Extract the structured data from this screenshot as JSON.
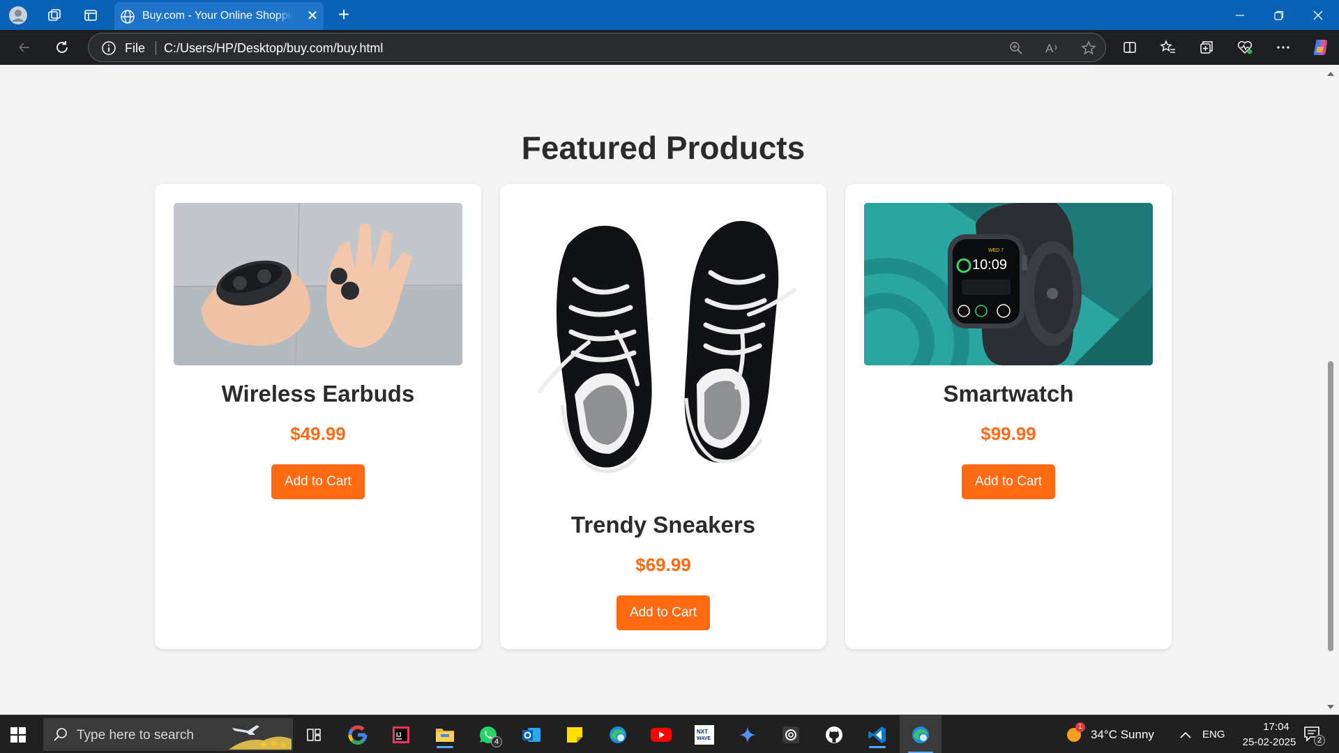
{
  "browser": {
    "tab_title": "Buy.com - Your Online Shopping Destination",
    "address_scheme": "File",
    "address_url": "C:/Users/HP/Desktop/buy.com/buy.html"
  },
  "page": {
    "heading": "Featured Products",
    "products": [
      {
        "name": "Wireless Earbuds",
        "price": "$49.99",
        "button": "Add to Cart",
        "image": "earbuds-photo"
      },
      {
        "name": "Trendy Sneakers",
        "price": "$69.99",
        "button": "Add to Cart",
        "image": "sneakers-photo"
      },
      {
        "name": "Smartwatch",
        "price": "$99.99",
        "button": "Add to Cart",
        "image": "smartwatch-photo"
      }
    ],
    "accent_color": "#ff6a13"
  },
  "taskbar": {
    "search_placeholder": "Type here to search",
    "whatsapp_badge": "4",
    "weather_badge": "1",
    "weather": "34°C  Sunny",
    "language": "ENG",
    "time": "17:04",
    "date": "25-02-2025",
    "notification_count": "2"
  }
}
